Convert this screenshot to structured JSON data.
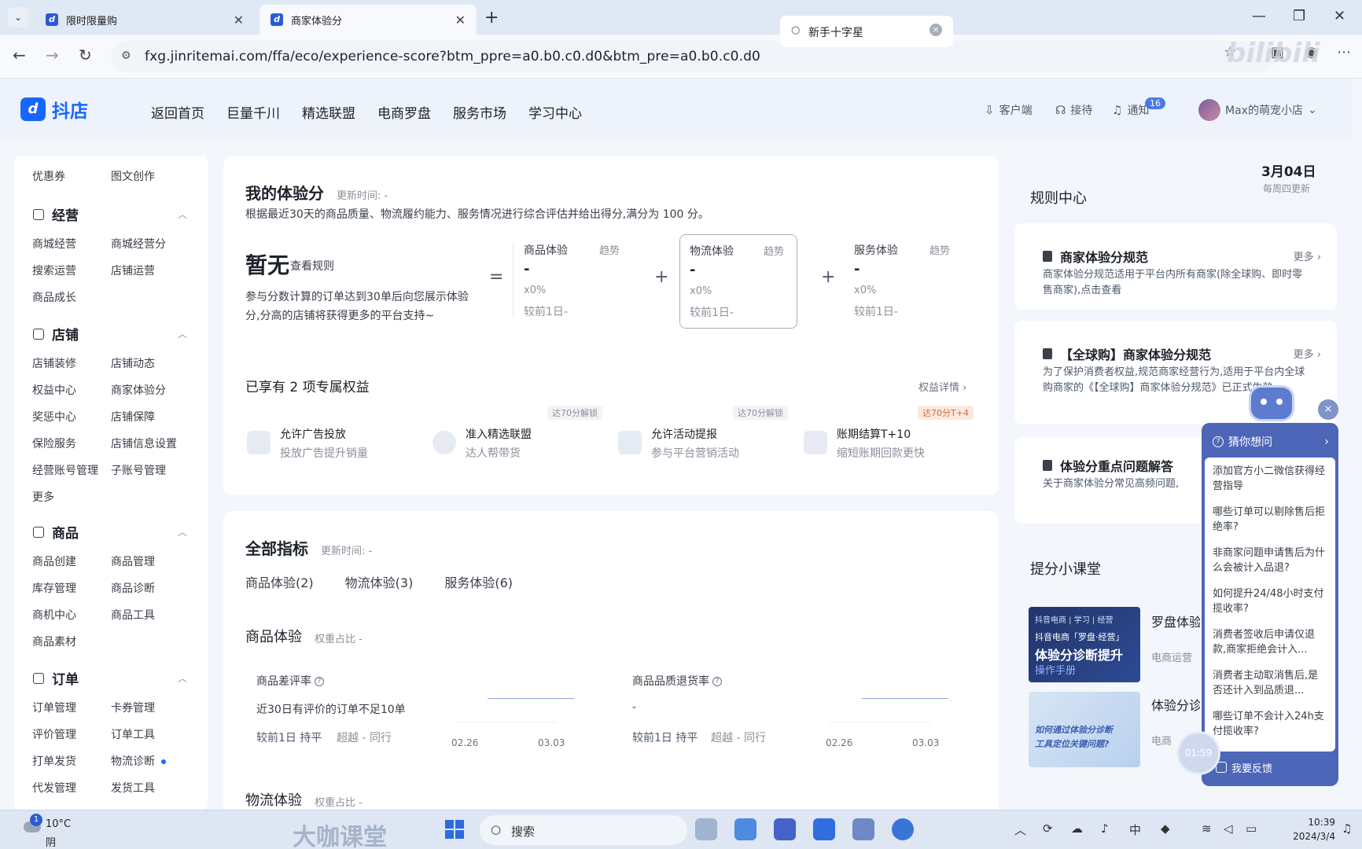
{
  "browser": {
    "tabs": [
      {
        "title": "限时限量购",
        "active": false
      },
      {
        "title": "商家体验分",
        "active": true
      }
    ],
    "url": "fxg.jinritemai.com/ffa/eco/experience-score?btm_ppre=a0.b0.c0.d0&btm_pre=a0.b0.c0.d0",
    "watermark": "bilibili"
  },
  "header": {
    "logo_text": "抖店",
    "logo_mark": "d",
    "nav": [
      "返回首页",
      "巨量千川",
      "精选联盟",
      "电商罗盘",
      "服务市场",
      "学习中心"
    ],
    "search_value": "新手十字星",
    "client_label": "客户端",
    "reception_label": "接待",
    "notice_label": "通知",
    "notice_count": "16",
    "shop_name": "Max的萌宠小店"
  },
  "sidebar": {
    "top_links": [
      "优惠券",
      "图文创作"
    ],
    "groups": [
      {
        "title": "经营",
        "items": [
          "商城经营",
          "商城经营分",
          "搜索运营",
          "店铺运营",
          "商品成长"
        ]
      },
      {
        "title": "店铺",
        "items": [
          "店铺装修",
          "店铺动态",
          "权益中心",
          "商家体验分",
          "奖惩中心",
          "店铺保障",
          "保险服务",
          "店铺信息设置",
          "经营账号管理",
          "子账号管理",
          "更多"
        ]
      },
      {
        "title": "商品",
        "items": [
          "商品创建",
          "商品管理",
          "库存管理",
          "商品诊断",
          "商机中心",
          "商品工具",
          "商品素材"
        ]
      },
      {
        "title": "订单",
        "items": [
          "订单管理",
          "卡券管理",
          "评价管理",
          "订单工具",
          "打单发货",
          "物流诊断",
          "代发管理",
          "发货工具"
        ]
      }
    ]
  },
  "score_card": {
    "title": "我的体验分",
    "update_label": "更新时间: -",
    "description": "根据最近30天的商品质量、物流履约能力、服务情况进行综合评估并给出得分,满分为 100 分。",
    "score_value": "暂无",
    "rules_link": "查看规则",
    "score_desc": "参与分数计算的订单达到30单后向您展示体验分,分高的店铺将获得更多的平台支持~",
    "equals": "=",
    "plus": "+",
    "metrics": [
      {
        "name": "商品体验",
        "trend": "趋势",
        "value": "-",
        "weight": "x0%",
        "compare": "较前1日-"
      },
      {
        "name": "物流体验",
        "trend": "趋势",
        "value": "-",
        "weight": "x0%",
        "compare": "较前1日-"
      },
      {
        "name": "服务体验",
        "trend": "趋势",
        "value": "-",
        "weight": "x0%",
        "compare": "较前1日-"
      }
    ],
    "perks_title": "已享有 2 项专属权益",
    "perks_link": "权益详情 ›",
    "perks": [
      {
        "title": "允许广告投放",
        "desc": "投放广告提升销量",
        "lock": ""
      },
      {
        "title": "准入精选联盟",
        "desc": "达人帮带货",
        "lock": "达70分解锁"
      },
      {
        "title": "允许活动提报",
        "desc": "参与平台营销活动",
        "lock": "达70分解锁"
      },
      {
        "title": "账期结算T+10",
        "desc": "缩短账期回款更快",
        "lock": "达70分T+4"
      }
    ]
  },
  "indicators": {
    "title": "全部指标",
    "update_label": "更新时间: -",
    "tabs": [
      "商品体验(2)",
      "物流体验(3)",
      "服务体验(6)"
    ],
    "section_title": "商品体验",
    "section_weight": "权重占比 -",
    "items": [
      {
        "name": "商品差评率",
        "value": "近30日有评价的订单不足10单",
        "compare": "较前1日 持平",
        "peer": "超越 - 同行",
        "x_start": "02.26",
        "x_end": "03.03"
      },
      {
        "name": "商品品质退货率",
        "value": "-",
        "compare": "较前1日 持平",
        "peer": "超越 - 同行",
        "x_start": "02.26",
        "x_end": "03.03"
      }
    ],
    "next_section": "物流体验",
    "next_weight": "权重占比 -"
  },
  "right": {
    "date": "3月04日",
    "date_sub": "每周四更新",
    "rules_title": "规则中心",
    "rules": [
      {
        "title": "商家体验分规范",
        "more": "更多 ›",
        "body": "商家体验分规范适用于平台内所有商家(除全球购、即时零售商家),点击查看"
      },
      {
        "title": "【全球购】商家体验分规范",
        "more": "更多 ›",
        "body": "为了保护消费者权益,规范商家经营行为,适用于平台内全球购商家的《【全球购】商家体验分规范》已正式生效"
      },
      {
        "title": "体验分重点问题解答",
        "more": "",
        "body": "关于商家体验分常见高频问题,"
      }
    ],
    "class_title": "提分小课堂",
    "courses": [
      {
        "tag": "抖音电商 | 学习 | 经营",
        "line1": "抖音电商「罗盘·经营」",
        "line2": "体验分诊断提升",
        "line3": "操作手册",
        "name": "罗盘体验分手册",
        "source": "电商运营"
      },
      {
        "tag": "",
        "line1": "如何通过体验分诊断",
        "line2": "工具定位关键问题?",
        "line3": "",
        "name": "体验分诊断教程系列",
        "source": "电商"
      }
    ]
  },
  "chat": {
    "header": "猜你想问",
    "questions": [
      "添加官方小二微信获得经营指导",
      "哪些订单可以剔除售后拒绝率?",
      "非商家问题申请售后为什么会被计入品退?",
      "如何提升24/48小时支付揽收率?",
      "消费者签收后申请仅退款,商家拒绝会计入...",
      "消费者主动取消售后,是否还计入到品质退...",
      "哪些订单不会计入24h支付揽收率?"
    ],
    "feedback": "我要反馈",
    "timer": "01:59"
  },
  "taskbar": {
    "temp": "10°C",
    "weather": "阴",
    "weather_badge": "1",
    "watermark": "大咖课堂",
    "search": "搜索",
    "time": "10:39",
    "date": "2024/3/4"
  }
}
